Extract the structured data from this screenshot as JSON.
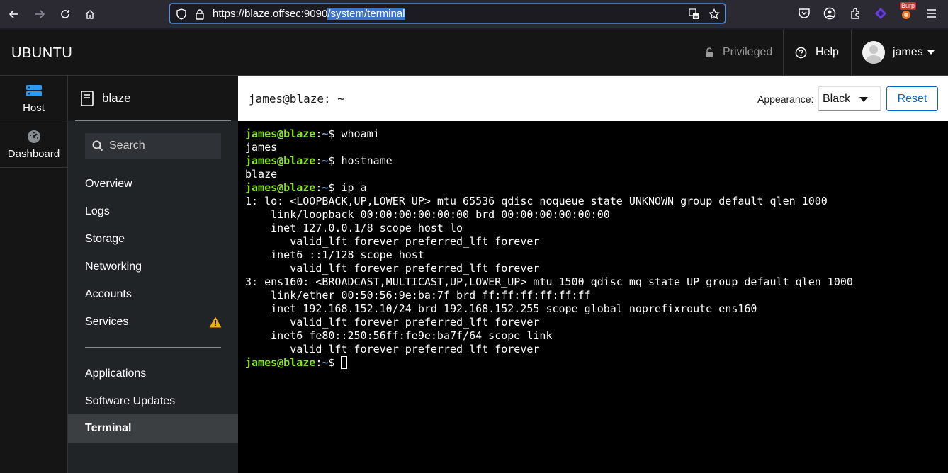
{
  "browser": {
    "url_base": "https://blaze.offsec:9090",
    "url_path": "/system/terminal",
    "extension_badge": "Burp"
  },
  "header": {
    "brand": "UBUNTU",
    "privileged": "Privileged",
    "help": "Help",
    "user": "james"
  },
  "vnav": {
    "host": "Host",
    "dashboard": "Dashboard"
  },
  "sidebar": {
    "host_name": "blaze",
    "search_placeholder": "Search",
    "items": [
      {
        "label": "Overview"
      },
      {
        "label": "Logs"
      },
      {
        "label": "Storage"
      },
      {
        "label": "Networking"
      },
      {
        "label": "Accounts"
      },
      {
        "label": "Services"
      },
      {
        "label": "Applications"
      },
      {
        "label": "Software Updates"
      },
      {
        "label": "Terminal"
      }
    ]
  },
  "terminal_header": {
    "title": "james@blaze: ~",
    "appearance_label": "Appearance:",
    "appearance_value": "Black",
    "reset_label": "Reset"
  },
  "terminal": {
    "prompt_user": "james@blaze",
    "prompt_path": "~",
    "lines": [
      {
        "type": "cmd",
        "text": "whoami"
      },
      {
        "type": "out",
        "text": "james"
      },
      {
        "type": "cmd",
        "text": "hostname"
      },
      {
        "type": "out",
        "text": "blaze"
      },
      {
        "type": "cmd",
        "text": "ip a"
      },
      {
        "type": "out",
        "text": "1: lo: <LOOPBACK,UP,LOWER_UP> mtu 65536 qdisc noqueue state UNKNOWN group default qlen 1000"
      },
      {
        "type": "out",
        "text": "    link/loopback 00:00:00:00:00:00 brd 00:00:00:00:00:00"
      },
      {
        "type": "out",
        "text": "    inet 127.0.0.1/8 scope host lo"
      },
      {
        "type": "out",
        "text": "       valid_lft forever preferred_lft forever"
      },
      {
        "type": "out",
        "text": "    inet6 ::1/128 scope host"
      },
      {
        "type": "out",
        "text": "       valid_lft forever preferred_lft forever"
      },
      {
        "type": "out",
        "text": "3: ens160: <BROADCAST,MULTICAST,UP,LOWER_UP> mtu 1500 qdisc mq state UP group default qlen 1000"
      },
      {
        "type": "out",
        "text": "    link/ether 00:50:56:9e:ba:7f brd ff:ff:ff:ff:ff:ff"
      },
      {
        "type": "out",
        "text": "    inet 192.168.152.10/24 brd 192.168.152.255 scope global noprefixroute ens160"
      },
      {
        "type": "out",
        "text": "       valid_lft forever preferred_lft forever"
      },
      {
        "type": "out",
        "text": "    inet6 fe80::250:56ff:fe9e:ba7f/64 scope link"
      },
      {
        "type": "out",
        "text": "       valid_lft forever preferred_lft forever"
      },
      {
        "type": "prompt",
        "text": ""
      }
    ]
  },
  "colors": {
    "prompt_user": "#8ae234",
    "prompt_path": "#729fcf",
    "accent": "#0066cc",
    "warning": "#f0ab00"
  }
}
